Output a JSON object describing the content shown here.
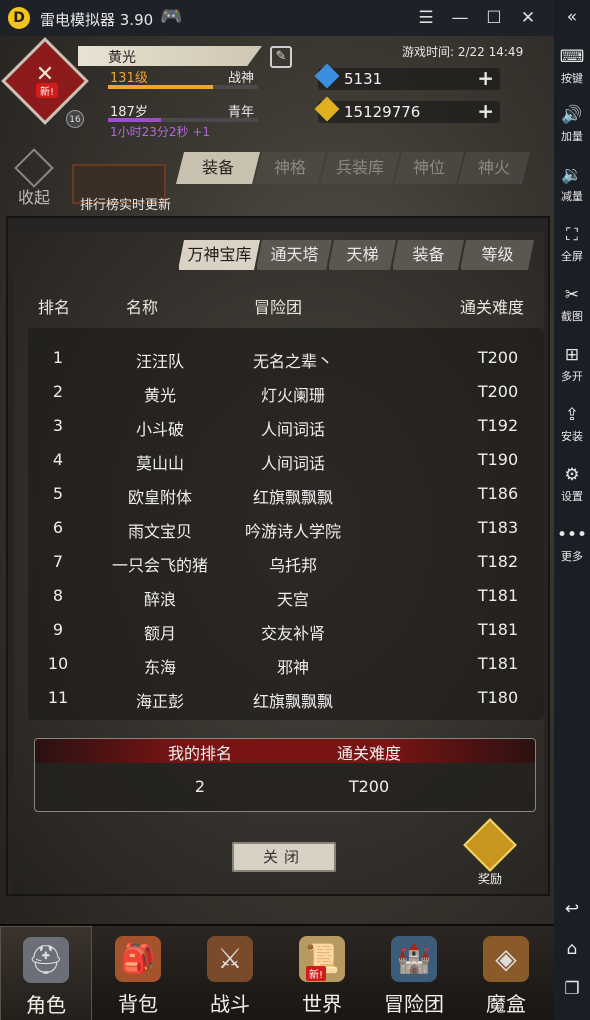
{
  "emulator": {
    "title": "雷电模拟器 3.90",
    "logo_glyph": "D",
    "icons": [
      "gamepad-icon",
      "menu-icon",
      "minimize-icon",
      "maximize-icon",
      "close-icon"
    ],
    "sidebar": [
      {
        "icon": "keyboard-icon",
        "glyph": "⌨",
        "label": "按键"
      },
      {
        "icon": "volume-up-icon",
        "glyph": "🔊",
        "label": "加量"
      },
      {
        "icon": "volume-down-icon",
        "glyph": "🔉",
        "label": "减量"
      },
      {
        "icon": "fullscreen-icon",
        "glyph": "⛶",
        "label": "全屏"
      },
      {
        "icon": "scissors-icon",
        "glyph": "✂",
        "label": "截图"
      },
      {
        "icon": "multi-open-icon",
        "glyph": "⊞",
        "label": "多开"
      },
      {
        "icon": "apk-install-icon",
        "glyph": "⇪",
        "label": "安装"
      },
      {
        "icon": "gear-icon",
        "glyph": "⚙",
        "label": "设置"
      },
      {
        "icon": "more-icon",
        "glyph": "•••",
        "label": "更多"
      }
    ],
    "nav_buttons": [
      {
        "icon": "back-icon",
        "glyph": "↩"
      },
      {
        "icon": "home-icon",
        "glyph": "⌂"
      },
      {
        "icon": "recent-apps-icon",
        "glyph": "❐"
      }
    ]
  },
  "player": {
    "name": "黄光",
    "level": "131级",
    "class": "战神",
    "age": "187岁",
    "stage": "青年",
    "timer": "1小时23分2秒 +1",
    "emblem_badge": "新!",
    "small_level": "16",
    "level_progress": 0.7,
    "age_progress": 0.35
  },
  "game_time": "游戏时间: 2/22 14:49",
  "resources": {
    "diamond": "5131",
    "gold": "15129776"
  },
  "collapse_label": "收起",
  "rank_tip": "排行榜实时更新",
  "top_tabs": [
    "装备",
    "神格",
    "兵装库",
    "神位",
    "神火"
  ],
  "panel": {
    "tabs": [
      "万神宝库",
      "通天塔",
      "天梯",
      "装备",
      "等级"
    ],
    "headers": {
      "rank": "排名",
      "name": "名称",
      "team": "冒险团",
      "difficulty": "通关难度"
    },
    "rows": [
      {
        "rank": "1",
        "name": "汪汪队",
        "team": "无名之辈丶",
        "difficulty": "T200"
      },
      {
        "rank": "2",
        "name": "黄光",
        "team": "灯火阑珊",
        "difficulty": "T200"
      },
      {
        "rank": "3",
        "name": "小斗破",
        "team": "人间词话",
        "difficulty": "T192"
      },
      {
        "rank": "4",
        "name": "莫山山",
        "team": "人间词话",
        "difficulty": "T190"
      },
      {
        "rank": "5",
        "name": "欧皇附体",
        "team": "红旗飘飘飘",
        "difficulty": "T186"
      },
      {
        "rank": "6",
        "name": "雨文宝贝",
        "team": "吟游诗人学院",
        "difficulty": "T183"
      },
      {
        "rank": "7",
        "name": "一只会飞的猪",
        "team": "乌托邦",
        "difficulty": "T182"
      },
      {
        "rank": "8",
        "name": "醉浪",
        "team": "天宫",
        "difficulty": "T181"
      },
      {
        "rank": "9",
        "name": "额月",
        "team": "交友补肾",
        "difficulty": "T181"
      },
      {
        "rank": "10",
        "name": "东海",
        "team": "邪神",
        "difficulty": "T181"
      },
      {
        "rank": "11",
        "name": "海正彭",
        "team": "红旗飘飘飘",
        "difficulty": "T180"
      }
    ],
    "my": {
      "rank_label": "我的排名",
      "diff_label": "通关难度",
      "rank": "2",
      "difficulty": "T200"
    },
    "close": "关闭",
    "reward": "奖励"
  },
  "bottom_nav": [
    {
      "label": "角色",
      "icon": "helmet-icon",
      "glyph": "⛑",
      "color": "#6c6f78"
    },
    {
      "label": "背包",
      "icon": "backpack-icon",
      "glyph": "🎒",
      "color": "#a5532c"
    },
    {
      "label": "战斗",
      "icon": "sword-shield-icon",
      "glyph": "⚔",
      "color": "#7a4b2a"
    },
    {
      "label": "世界",
      "icon": "scroll-map-icon",
      "glyph": "📜",
      "color": "#b69a62",
      "badge": "新!"
    },
    {
      "label": "冒险团",
      "icon": "castle-icon",
      "glyph": "🏰",
      "color": "#3d5c7a"
    },
    {
      "label": "魔盒",
      "icon": "magic-box-icon",
      "glyph": "◈",
      "color": "#8a5a2a"
    }
  ],
  "colors": {
    "accent_red": "#7a1414",
    "level_text": "#f2a331",
    "timer_text": "#b06adc",
    "diamond": "#3b8fe0",
    "gold": "#e0b020"
  }
}
